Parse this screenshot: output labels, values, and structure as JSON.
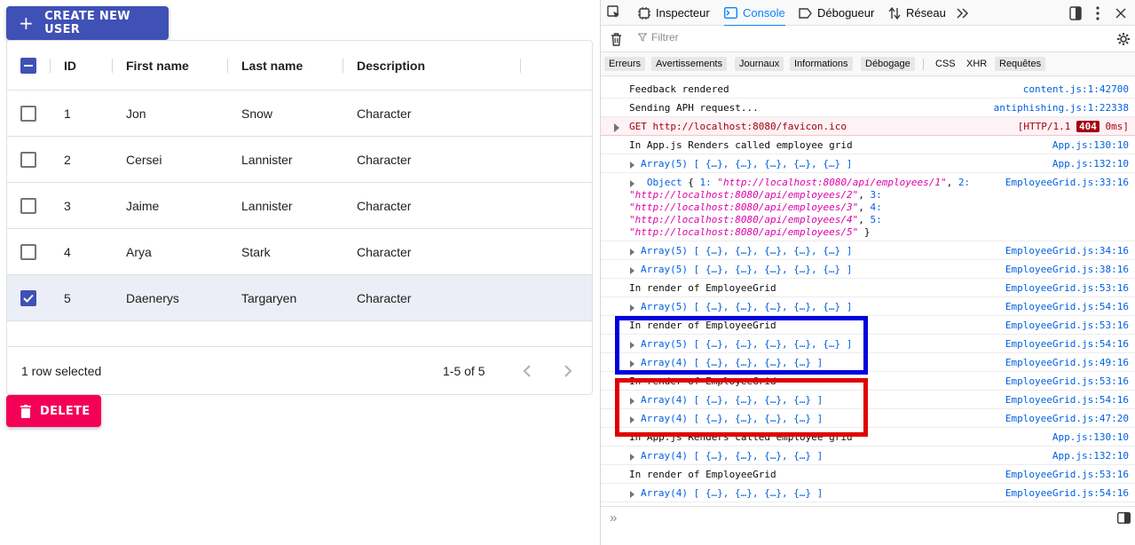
{
  "app": {
    "create_label": "CREATE NEW USER",
    "delete_label": "DELETE",
    "columns": [
      "ID",
      "First name",
      "Last name",
      "Description"
    ],
    "rows": [
      {
        "id": "1",
        "first": "Jon",
        "last": "Snow",
        "desc": "Character",
        "checked": false
      },
      {
        "id": "2",
        "first": "Cersei",
        "last": "Lannister",
        "desc": "Character",
        "checked": false
      },
      {
        "id": "3",
        "first": "Jaime",
        "last": "Lannister",
        "desc": "Character",
        "checked": false
      },
      {
        "id": "4",
        "first": "Arya",
        "last": "Stark",
        "desc": "Character",
        "checked": false
      },
      {
        "id": "5",
        "first": "Daenerys",
        "last": "Targaryen",
        "desc": "Character",
        "checked": true
      }
    ],
    "footer": {
      "selected_text": "1 row selected",
      "range_text": "1-5 of 5"
    },
    "colors": {
      "primary": "#3f51b5",
      "secondary": "#f50057"
    }
  },
  "devtools": {
    "tabs": [
      {
        "label": "Inspecteur",
        "icon": "inspector-icon"
      },
      {
        "label": "Console",
        "icon": "console-icon"
      },
      {
        "label": "Débogueur",
        "icon": "debugger-icon"
      },
      {
        "label": "Réseau",
        "icon": "network-icon"
      }
    ],
    "filter_placeholder": "Filtrer",
    "categories": [
      "Erreurs",
      "Avertissements",
      "Journaux",
      "Informations",
      "Débogage",
      "CSS",
      "XHR",
      "Requêtes"
    ],
    "messages": [
      {
        "text": "Feedback rendered",
        "src": "content.js:1:42700"
      },
      {
        "text": "Sending APH request...",
        "src": "antiphishing.js:1:22338"
      },
      {
        "text": "GET http://localhost:8080/favicon.ico",
        "src_pre": "[HTTP/1.1 ",
        "status": "404",
        "src_post": " 0ms]",
        "type": "error"
      },
      {
        "text": "In App.js Renders called employee grid",
        "src": "App.js:130:10"
      },
      {
        "text": "Array(5) [ {…}, {…}, {…}, {…}, {…} ]",
        "src": "App.js:132:10"
      },
      {
        "text": "Object { 1: \"http://localhost:8080/api/employees/1\", 2:\n\"http://localhost:8080/api/employees/2\", 3:\n\"http://localhost:8080/api/employees/3\", 4:\n\"http://localhost:8080/api/employees/4\", 5:\n\"http://localhost:8080/api/employees/5\" }",
        "src": "EmployeeGrid.js:33:16"
      },
      {
        "text": "Array(5) [ {…}, {…}, {…}, {…}, {…} ]",
        "src": "EmployeeGrid.js:34:16"
      },
      {
        "text": "Array(5) [ {…}, {…}, {…}, {…}, {…} ]",
        "src": "EmployeeGrid.js:38:16"
      },
      {
        "text": "In render of EmployeeGrid",
        "src": "EmployeeGrid.js:53:16"
      },
      {
        "text": "Array(5) [ {…}, {…}, {…}, {…}, {…} ]",
        "src": "EmployeeGrid.js:54:16"
      },
      {
        "text": "In render of EmployeeGrid",
        "src": "EmployeeGrid.js:53:16"
      },
      {
        "text": "Array(5) [ {…}, {…}, {…}, {…}, {…} ]",
        "src": "EmployeeGrid.js:54:16"
      },
      {
        "text": "Array(4) [ {…}, {…}, {…}, {…} ]",
        "src": "EmployeeGrid.js:49:16"
      },
      {
        "text": "In render of EmployeeGrid",
        "src": "EmployeeGrid.js:53:16"
      },
      {
        "text": "Array(4) [ {…}, {…}, {…}, {…} ]",
        "src": "EmployeeGrid.js:54:16"
      },
      {
        "text": "Array(4) [ {…}, {…}, {…}, {…} ]",
        "src": "EmployeeGrid.js:47:20"
      },
      {
        "text": "In App.js Renders called employee grid",
        "src": "App.js:130:10"
      },
      {
        "text": "Array(4) [ {…}, {…}, {…}, {…} ]",
        "src": "App.js:132:10"
      },
      {
        "text": "In render of EmployeeGrid",
        "src": "EmployeeGrid.js:53:16"
      },
      {
        "text": "Array(4) [ {…}, {…}, {…}, {…} ]",
        "src": "EmployeeGrid.js:54:16"
      }
    ],
    "input_prompt": "»",
    "annotation_colors": {
      "blue": "#0000dc",
      "red": "#e10000"
    }
  }
}
